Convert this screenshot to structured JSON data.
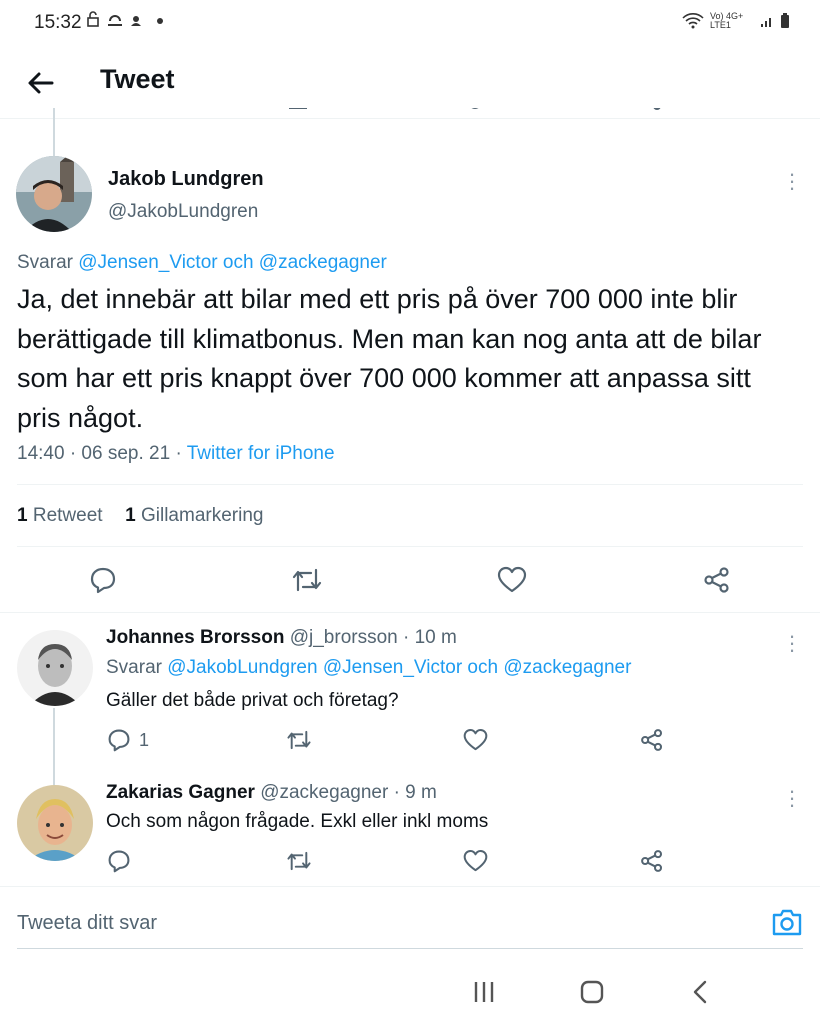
{
  "status_bar": {
    "time": "15:32",
    "network": "Vo) 4G+ LTE1",
    "battery": "battery-icon"
  },
  "header": {
    "title": "Tweet"
  },
  "main_tweet": {
    "author_name": "Jakob Lundgren",
    "author_handle": "@JakobLundgren",
    "reply_prefix": "Svarar",
    "reply_to": "@Jensen_Victor och @zackegagner",
    "text": "Ja, det innebär att bilar med ett pris på över 700 000 inte blir berättigade till klimatbonus. Men man kan nog anta att de bilar som har ett pris knappt över 700 000 kommer att anpassa sitt pris något.",
    "timestamp": "14:40 · 06 sep. 21 · ",
    "source": "Twitter for iPhone",
    "retweet_count": "1",
    "retweet_label": "Retweet",
    "like_count": "1",
    "like_label": "Gillamarkering"
  },
  "replies": [
    {
      "name": "Johannes Brorsson",
      "handle_time": "@j_brorsson · 10 m",
      "reply_prefix": "Svarar",
      "reply_to": "@JakobLundgren @Jensen_Victor och @zackegagner",
      "text": "Gäller det både privat och företag?",
      "reply_count": "1"
    },
    {
      "name": "Zakarias Gagner",
      "handle_time": "@zackegagner · 9 m",
      "text": "Och som någon frågade. Exkl eller inkl moms"
    }
  ],
  "compose": {
    "placeholder": "Tweeta ditt svar"
  },
  "colors": {
    "accent": "#1d9bf0",
    "muted": "#536471",
    "text": "#0f1419"
  }
}
